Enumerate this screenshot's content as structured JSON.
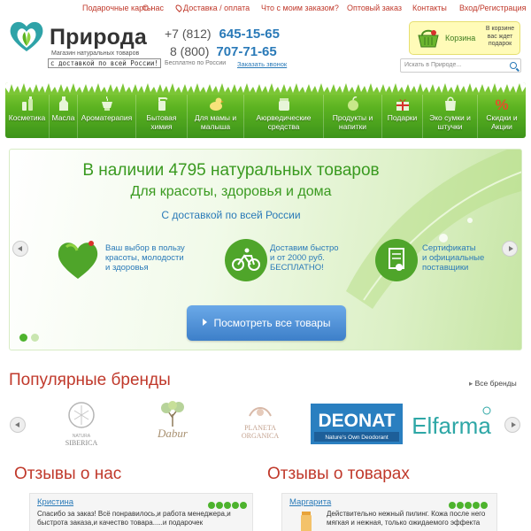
{
  "top_nav": {
    "items": [
      "Подарочные карты",
      "О нас",
      "Доставка / оплата",
      "Что с моим заказом?",
      "Оптовый заказ",
      "Контакты",
      "Вход/Регистрация"
    ]
  },
  "logo": {
    "name": "Природа",
    "tagline1": "Магазин натуральных товаров",
    "tagline2": "с доставкой по всей России!"
  },
  "phones": {
    "line1_code": "+7 (812)",
    "line1_num": "645-15-65",
    "line2_code": "8 (800)",
    "line2_num": "707-71-65",
    "free": "Бесплатно по России",
    "callback": "Заказать звонок"
  },
  "cart": {
    "label": "Корзина",
    "note": "В корзине вас ждет подарок"
  },
  "search": {
    "placeholder": "Искать в Природе..."
  },
  "categories": [
    {
      "label": "Косметика",
      "icon": "cosmetics-icon"
    },
    {
      "label": "Масла",
      "icon": "oil-bottle-icon"
    },
    {
      "label": "Ароматерапия",
      "icon": "aroma-lamp-icon"
    },
    {
      "label": "Бытовая\nхимия",
      "icon": "spray-bottle-icon"
    },
    {
      "label": "Для мамы и\nмалыша",
      "icon": "duck-toy-icon"
    },
    {
      "label": "Аюрведические\nсредства",
      "icon": "ayurveda-jar-icon"
    },
    {
      "label": "Продукты и\nнапитки",
      "icon": "apple-icon"
    },
    {
      "label": "Подарки",
      "icon": "gift-icon"
    },
    {
      "label": "Эко сумки и\nштучки",
      "icon": "eco-bag-icon"
    },
    {
      "label": "Скидки и\nАкции",
      "icon": "percent-icon"
    }
  ],
  "banner": {
    "title": "В наличии 4795 натуральных товаров",
    "subtitle": "Для красоты, здоровья и дома",
    "delivery": "С доставкой по всей России",
    "features": [
      {
        "text": "Ваш выбор в пользу\nкрасоты, молодости\nи здоровья",
        "icon": "heart-icon"
      },
      {
        "text": "Доставим быстро\nи от 2000 руб.\nБЕСПЛАТНО!",
        "icon": "bicycle-icon"
      },
      {
        "text": "Сертификаты\nи официальные\nпоставщики",
        "icon": "certificate-icon"
      }
    ],
    "button": "Посмотреть все товары"
  },
  "brands": {
    "title": "Популярные бренды",
    "all_link": "Все бренды",
    "items": [
      {
        "name": "NATURA SIBERICA"
      },
      {
        "name": "Dabur"
      },
      {
        "name": "PLANETA ORGANICA"
      },
      {
        "name": "DEONAT"
      },
      {
        "name": "Elfarma"
      }
    ]
  },
  "reviews": {
    "shop_title": "Отзывы о нас",
    "goods_title": "Отзывы о товарах",
    "shop": {
      "name": "Кристина",
      "stars": 5,
      "line1": "Спасибо за заказ! Всё понравилось,и работа менеджера,и",
      "line2": "быстрота заказа,и качество товара.....и подарочек"
    },
    "goods": {
      "name": "Маргарита",
      "stars": 5,
      "line1": "Действительно нежный пилинг. Кожа после него",
      "line2": "мягкая и нежная, только ожидаемого эффекта"
    }
  },
  "colors": {
    "red_accent": "#c0392b",
    "green": "#3a9a20",
    "blue": "#2a7ab8",
    "star_green": "#4db32d"
  }
}
